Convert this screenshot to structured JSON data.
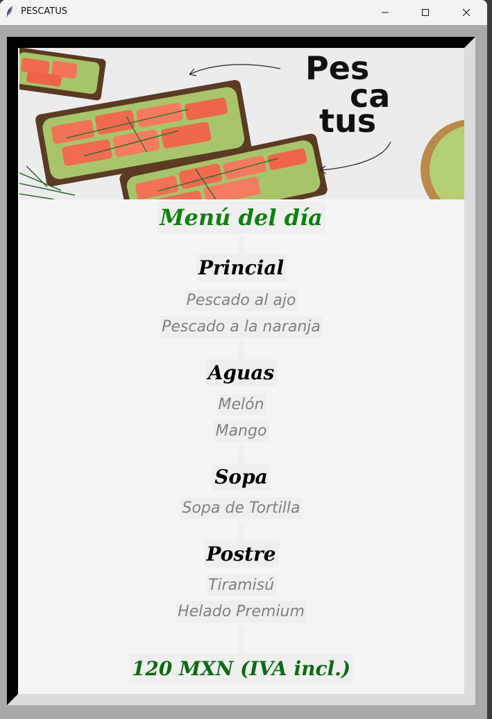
{
  "window": {
    "title": "PESCATUS",
    "controls": {
      "minimize_icon": "minimize-icon",
      "maximize_icon": "maximize-icon",
      "close_icon": "close-icon"
    }
  },
  "banner": {
    "logo_lines": [
      "Pes",
      "ca",
      "tus"
    ]
  },
  "menu": {
    "title": "Menú del día",
    "sections": [
      {
        "heading": "Princial",
        "items": [
          "Pescado al ajo",
          "Pescado a la naranja"
        ]
      },
      {
        "heading": "Aguas",
        "items": [
          "Melón",
          "Mango"
        ]
      },
      {
        "heading": "Sopa",
        "items": [
          "Sopa de Tortilla"
        ]
      },
      {
        "heading": "Postre",
        "items": [
          "Tiramisú",
          "Helado Premium"
        ]
      }
    ],
    "price": "120 MXN (IVA incl.)"
  },
  "colors": {
    "title_green": "#108010",
    "price_green": "#0d6a12",
    "item_gray": "#808080",
    "heading_black": "#000000"
  }
}
